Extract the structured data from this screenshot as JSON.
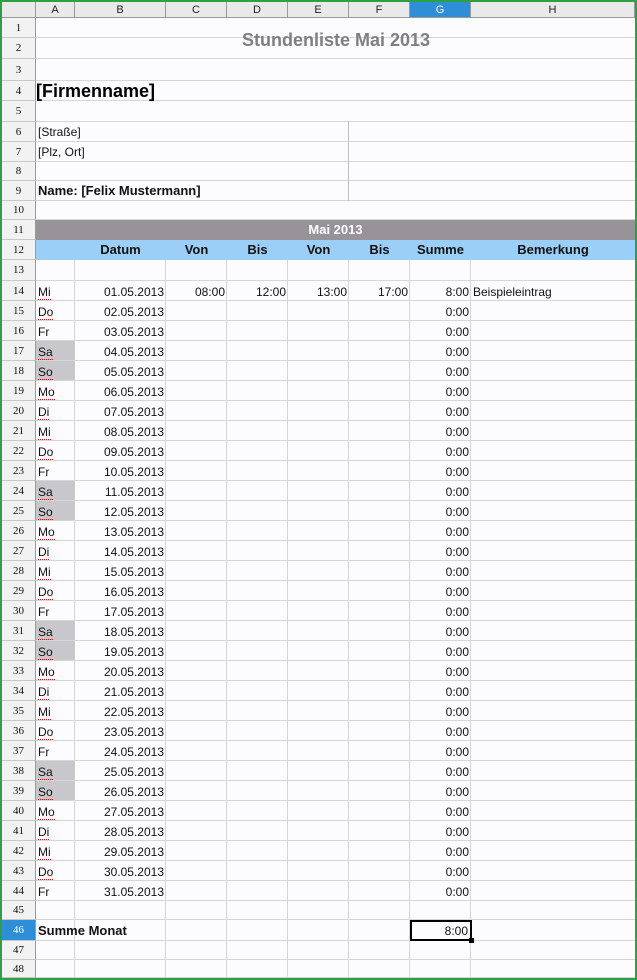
{
  "columns": [
    "A",
    "B",
    "C",
    "D",
    "E",
    "F",
    "G",
    "H"
  ],
  "selected_column": "G",
  "selected_row": "46",
  "rows": [
    "1",
    "2",
    "3",
    "4",
    "5",
    "6",
    "7",
    "8",
    "9",
    "10",
    "11",
    "12",
    "13",
    "14",
    "15",
    "16",
    "17",
    "18",
    "19",
    "20",
    "21",
    "22",
    "23",
    "24",
    "25",
    "26",
    "27",
    "28",
    "29",
    "30",
    "31",
    "32",
    "33",
    "34",
    "35",
    "36",
    "37",
    "38",
    "39",
    "40",
    "41",
    "42",
    "43",
    "44",
    "45",
    "46",
    "47",
    "48"
  ],
  "sheet": {
    "title": "Stundenliste Mai 2013",
    "company": "[Firmenname]",
    "street": "[Straße]",
    "city": "[Plz, Ort]",
    "name_line": "Name: [Felix Mustermann]",
    "month_band": "Mai 2013",
    "headers": [
      "Datum",
      "Von",
      "Bis",
      "Von",
      "Bis",
      "Summe",
      "Bemerkung"
    ],
    "entries": [
      {
        "day": "Mi",
        "date": "01.05.2013",
        "von1": "08:00",
        "bis1": "12:00",
        "von2": "13:00",
        "bis2": "17:00",
        "sum": "8:00",
        "note": "Beispieleintrag"
      },
      {
        "day": "Do",
        "date": "02.05.2013",
        "sum": "0:00"
      },
      {
        "day": "Fr",
        "date": "03.05.2013",
        "sum": "0:00"
      },
      {
        "day": "Sa",
        "date": "04.05.2013",
        "sum": "0:00",
        "weekend": true
      },
      {
        "day": "So",
        "date": "05.05.2013",
        "sum": "0:00",
        "weekend": true
      },
      {
        "day": "Mo",
        "date": "06.05.2013",
        "sum": "0:00"
      },
      {
        "day": "Di",
        "date": "07.05.2013",
        "sum": "0:00"
      },
      {
        "day": "Mi",
        "date": "08.05.2013",
        "sum": "0:00"
      },
      {
        "day": "Do",
        "date": "09.05.2013",
        "sum": "0:00"
      },
      {
        "day": "Fr",
        "date": "10.05.2013",
        "sum": "0:00"
      },
      {
        "day": "Sa",
        "date": "11.05.2013",
        "sum": "0:00",
        "weekend": true
      },
      {
        "day": "So",
        "date": "12.05.2013",
        "sum": "0:00",
        "weekend": true
      },
      {
        "day": "Mo",
        "date": "13.05.2013",
        "sum": "0:00"
      },
      {
        "day": "Di",
        "date": "14.05.2013",
        "sum": "0:00"
      },
      {
        "day": "Mi",
        "date": "15.05.2013",
        "sum": "0:00"
      },
      {
        "day": "Do",
        "date": "16.05.2013",
        "sum": "0:00"
      },
      {
        "day": "Fr",
        "date": "17.05.2013",
        "sum": "0:00"
      },
      {
        "day": "Sa",
        "date": "18.05.2013",
        "sum": "0:00",
        "weekend": true
      },
      {
        "day": "So",
        "date": "19.05.2013",
        "sum": "0:00",
        "weekend": true
      },
      {
        "day": "Mo",
        "date": "20.05.2013",
        "sum": "0:00"
      },
      {
        "day": "Di",
        "date": "21.05.2013",
        "sum": "0:00"
      },
      {
        "day": "Mi",
        "date": "22.05.2013",
        "sum": "0:00"
      },
      {
        "day": "Do",
        "date": "23.05.2013",
        "sum": "0:00"
      },
      {
        "day": "Fr",
        "date": "24.05.2013",
        "sum": "0:00"
      },
      {
        "day": "Sa",
        "date": "25.05.2013",
        "sum": "0:00",
        "weekend": true
      },
      {
        "day": "So",
        "date": "26.05.2013",
        "sum": "0:00",
        "weekend": true
      },
      {
        "day": "Mo",
        "date": "27.05.2013",
        "sum": "0:00"
      },
      {
        "day": "Di",
        "date": "28.05.2013",
        "sum": "0:00"
      },
      {
        "day": "Mi",
        "date": "29.05.2013",
        "sum": "0:00"
      },
      {
        "day": "Do",
        "date": "30.05.2013",
        "sum": "0:00"
      },
      {
        "day": "Fr",
        "date": "31.05.2013",
        "sum": "0:00"
      }
    ],
    "total_label": "Summe Monat",
    "total_value": "8:00"
  },
  "colors": {
    "band_grey": "#979399",
    "band_blue": "#9ccff7",
    "selection": "#2e8ed8",
    "weekend": "#c8c8cc",
    "frame": "#2ea043"
  }
}
